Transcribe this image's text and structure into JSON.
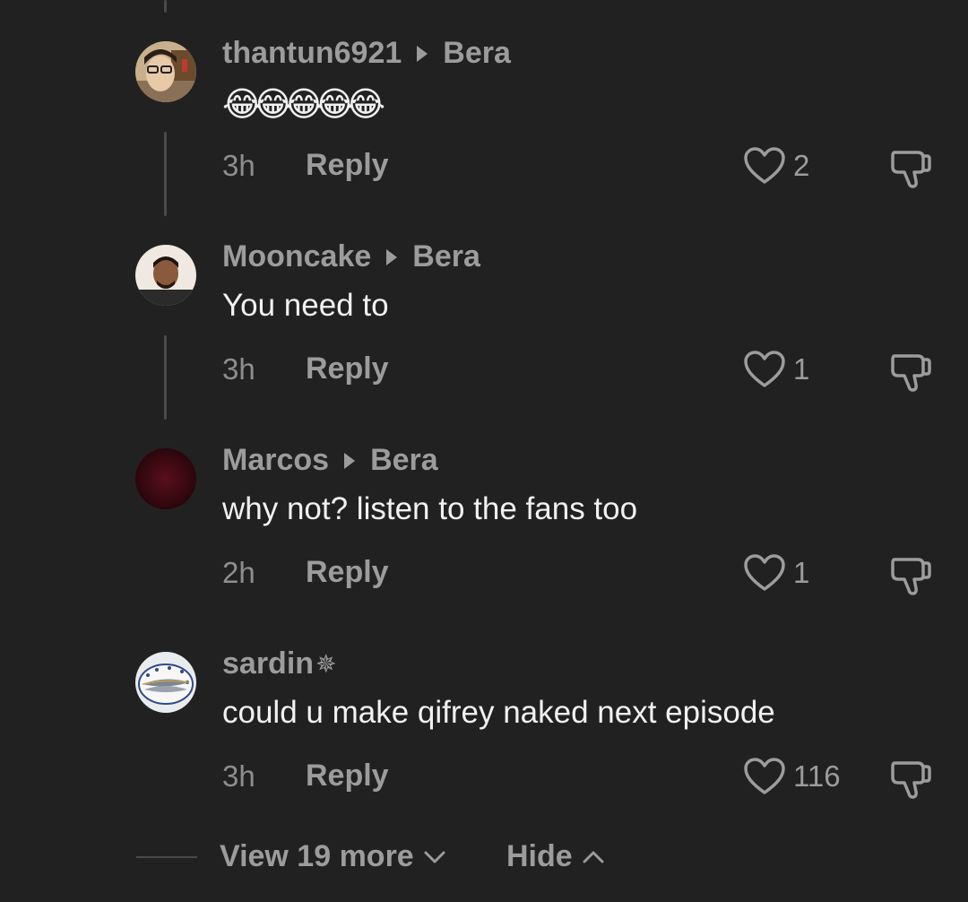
{
  "comments": [
    {
      "author": "thantun6921",
      "reply_to": "Bera",
      "text": "😂😂😂😂😂",
      "time": "3h",
      "reply_label": "Reply",
      "likes": "2"
    },
    {
      "author": "Mooncake",
      "reply_to": "Bera",
      "text": "You need to",
      "time": "3h",
      "reply_label": "Reply",
      "likes": "1"
    },
    {
      "author": "Marcos",
      "reply_to": "Bera",
      "text": "why not? listen to the fans too",
      "time": "2h",
      "reply_label": "Reply",
      "likes": "1"
    },
    {
      "author": "sardin",
      "author_badge": "✵",
      "text": "could u make qifrey naked next episode",
      "time": "3h",
      "reply_label": "Reply",
      "likes": "116"
    }
  ],
  "footer": {
    "view_more_label": "View 19 more",
    "hide_label": "Hide"
  },
  "icons": {
    "like": "heart-outline-icon",
    "dislike": "thumbs-down-outline-icon",
    "reply_arrow": "triangle-right-icon",
    "expand": "chevron-down-icon",
    "collapse": "chevron-up-icon"
  },
  "colors": {
    "background": "#212121",
    "author": "#9c9c9c",
    "body_text": "#f1f1f1",
    "meta": "#8e8e8e",
    "thread_line": "#4a4a4a"
  }
}
